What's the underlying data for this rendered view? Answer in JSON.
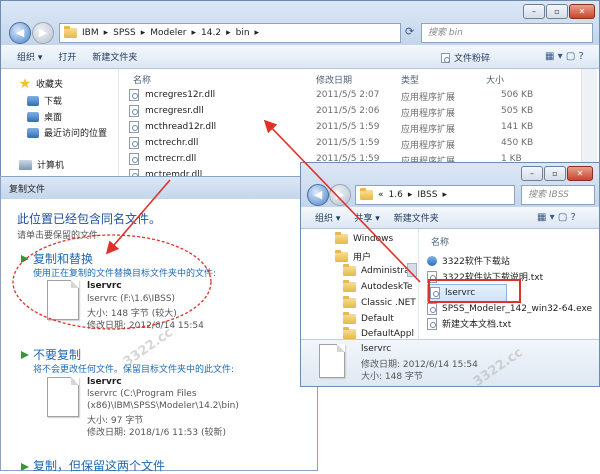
{
  "bg_window": {
    "breadcrumb": [
      "IBM",
      "SPSS",
      "Modeler",
      "14.2",
      "bin"
    ],
    "search_placeholder": "搜索 bin",
    "toolbar": [
      "组织 ▾",
      "打开",
      "新建文件夹"
    ],
    "share_label": "文件粉碎",
    "columns": [
      "名称",
      "修改日期",
      "类型",
      "大小"
    ],
    "nav": [
      "收藏夹",
      "下载",
      "桌面",
      "最近访问的位置",
      "计算机"
    ],
    "files": [
      {
        "name": "mcregres12r.dll",
        "date": "2011/5/5 2:07",
        "type": "应用程序扩展",
        "size": "506 KB"
      },
      {
        "name": "mcregresr.dll",
        "date": "2011/5/5 2:06",
        "type": "应用程序扩展",
        "size": "505 KB"
      },
      {
        "name": "mcthread12r.dll",
        "date": "2011/5/5 1:59",
        "type": "应用程序扩展",
        "size": "141 KB"
      },
      {
        "name": "mctrechr.dll",
        "date": "2011/5/5 1:59",
        "type": "应用程序扩展",
        "size": "450 KB"
      },
      {
        "name": "mctrecrr.dll",
        "date": "2011/5/5 1:59",
        "type": "应用程序扩展",
        "size": "1 KB"
      },
      {
        "name": "mctremdr.dll",
        "date": "",
        "type": "",
        "size": ""
      }
    ]
  },
  "copy_dialog": {
    "title": "复制文件",
    "heading": "此位置已经包含同名文件。",
    "subheading": "请单击要保留的文件",
    "opt1": {
      "title": "复制和替换",
      "desc": "使用正在复制的文件替换目标文件夹中的文件:",
      "file": "lservrc",
      "path": "lservrc (F:\\1.6\\IBSS)",
      "size": "大小: 148 字节 (较大)",
      "date": "修改日期: 2012/6/14 15:54"
    },
    "opt2": {
      "title": "不要复制",
      "desc": "将不会更改任何文件。保留目标文件夹中的此文件:",
      "file": "lservrc",
      "path1": "lservrc (C:\\Program Files",
      "path2": "(x86)\\IBM\\SPSS\\Modeler\\14.2\\bin)",
      "size": "大小: 97 字节",
      "date": "修改日期: 2018/1/6 11:53 (较新)"
    },
    "opt3": {
      "title": "复制，但保留这两个文件"
    }
  },
  "src_window": {
    "breadcrumb": [
      "«",
      "1.6",
      "IBSS"
    ],
    "search_placeholder": "搜索 IBSS",
    "toolbar": [
      "组织 ▾",
      "共享 ▾",
      "新建文件夹"
    ],
    "column": "名称",
    "nav": [
      "Windows",
      "用户",
      "Administrat",
      "AutodeskTe",
      "Classic .NET",
      "Default",
      "DefaultAppl"
    ],
    "files": [
      "3322软件下载站",
      "3322软件站下载说明.txt",
      "lservrc",
      "SPSS_Modeler_142_win32-64.exe",
      "新建文本文档.txt"
    ],
    "details": {
      "name": "lservrc",
      "date": "修改日期: 2012/6/14 15:54",
      "size": "大小: 148 字节"
    }
  },
  "watermark": "3322.cc",
  "colors": {
    "arrow": "#e0312b",
    "ellipse": "#e0312b",
    "highlight": "#e0312b",
    "link": "#1f6ab6"
  }
}
